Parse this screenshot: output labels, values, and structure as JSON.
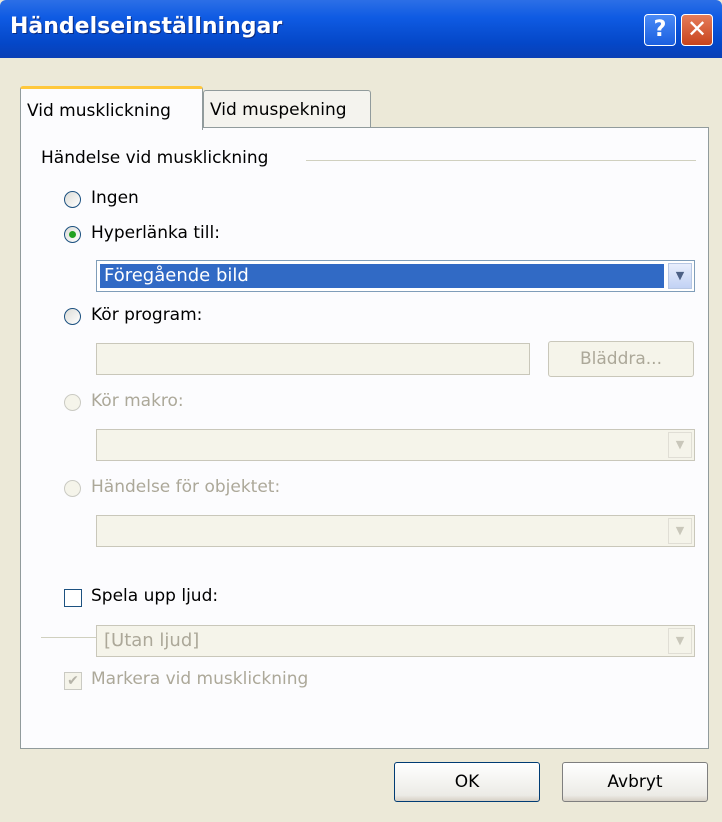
{
  "window": {
    "title": "Händelseinställningar",
    "help_label": "?",
    "close_label": "✕"
  },
  "tabs": [
    {
      "label": "Vid musklickning",
      "active": true
    },
    {
      "label": "Vid muspekning",
      "active": false
    }
  ],
  "group": {
    "label": "Händelse vid musklickning"
  },
  "options": {
    "none": {
      "label": "Ingen",
      "selected": false,
      "enabled": true
    },
    "hyperlink": {
      "label": "Hyperlänka till:",
      "selected": true,
      "enabled": true,
      "value": "Föregående bild"
    },
    "run_program": {
      "label": "Kör program:",
      "selected": false,
      "enabled": true,
      "value": "",
      "browse_label": "Bläddra..."
    },
    "run_macro": {
      "label": "Kör makro:",
      "selected": false,
      "enabled": false,
      "value": ""
    },
    "object_action": {
      "label": "Händelse för objektet:",
      "selected": false,
      "enabled": false,
      "value": ""
    }
  },
  "sound": {
    "label": "Spela upp ljud:",
    "checked": false,
    "value": "[Utan ljud]"
  },
  "highlight": {
    "label": "Markera vid musklickning",
    "checked": true,
    "enabled": false
  },
  "buttons": {
    "ok": "OK",
    "cancel": "Avbryt"
  },
  "colors": {
    "titlebar": "#0447C8",
    "dialog_bg": "#ECE9D8",
    "selection": "#316AC5",
    "radio_dot": "#21A121"
  },
  "icons": {
    "help": "question-mark",
    "close": "x-close",
    "dropdown": "chevron-down",
    "checkmark": "check"
  }
}
